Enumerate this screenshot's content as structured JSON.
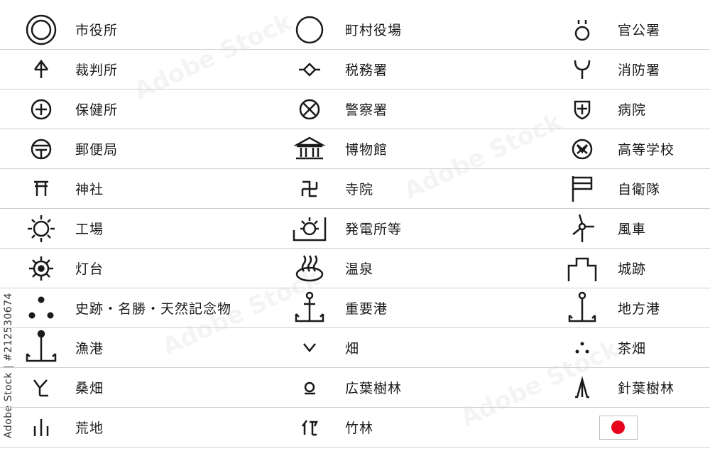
{
  "stock_id": "Adobe Stock | #212530674",
  "watermark_text": "Adobe Stock",
  "columns": [
    [
      {
        "label": "市役所",
        "icon": "city-hall-icon"
      },
      {
        "label": "裁判所",
        "icon": "courthouse-icon"
      },
      {
        "label": "保健所",
        "icon": "health-center-icon"
      },
      {
        "label": "郵便局",
        "icon": "post-office-icon"
      },
      {
        "label": "神社",
        "icon": "shrine-icon"
      },
      {
        "label": "工場",
        "icon": "factory-icon"
      },
      {
        "label": "灯台",
        "icon": "lighthouse-icon"
      },
      {
        "label": "史跡・名勝・天然記念物",
        "icon": "historic-site-icon"
      },
      {
        "label": "漁港",
        "icon": "fishing-port-icon"
      },
      {
        "label": "桑畑",
        "icon": "mulberry-field-icon"
      },
      {
        "label": "荒地",
        "icon": "wasteland-icon"
      }
    ],
    [
      {
        "label": "町村役場",
        "icon": "town-office-icon"
      },
      {
        "label": "税務署",
        "icon": "tax-office-icon"
      },
      {
        "label": "警察署",
        "icon": "police-station-icon"
      },
      {
        "label": "博物館",
        "icon": "museum-icon"
      },
      {
        "label": "寺院",
        "icon": "temple-icon"
      },
      {
        "label": "発電所等",
        "icon": "power-plant-icon"
      },
      {
        "label": "温泉",
        "icon": "hot-spring-icon"
      },
      {
        "label": "重要港",
        "icon": "major-port-icon"
      },
      {
        "label": "畑",
        "icon": "field-icon"
      },
      {
        "label": "広葉樹林",
        "icon": "broadleaf-forest-icon"
      },
      {
        "label": "竹林",
        "icon": "bamboo-forest-icon"
      }
    ],
    [
      {
        "label": "官公署",
        "icon": "government-office-icon"
      },
      {
        "label": "消防署",
        "icon": "fire-station-icon"
      },
      {
        "label": "病院",
        "icon": "hospital-icon"
      },
      {
        "label": "高等学校",
        "icon": "high-school-icon"
      },
      {
        "label": "自衛隊",
        "icon": "self-defense-force-icon"
      },
      {
        "label": "風車",
        "icon": "windmill-icon"
      },
      {
        "label": "城跡",
        "icon": "castle-ruins-icon"
      },
      {
        "label": "地方港",
        "icon": "local-port-icon"
      },
      {
        "label": "茶畑",
        "icon": "tea-field-icon"
      },
      {
        "label": "針葉樹林",
        "icon": "conifer-forest-icon"
      },
      {
        "label": "",
        "icon": "japan-flag-icon"
      }
    ]
  ],
  "colors": {
    "flag_sun": "#e8001c",
    "symbol": "#1a1a1a",
    "divider": "#cfcfcf"
  }
}
